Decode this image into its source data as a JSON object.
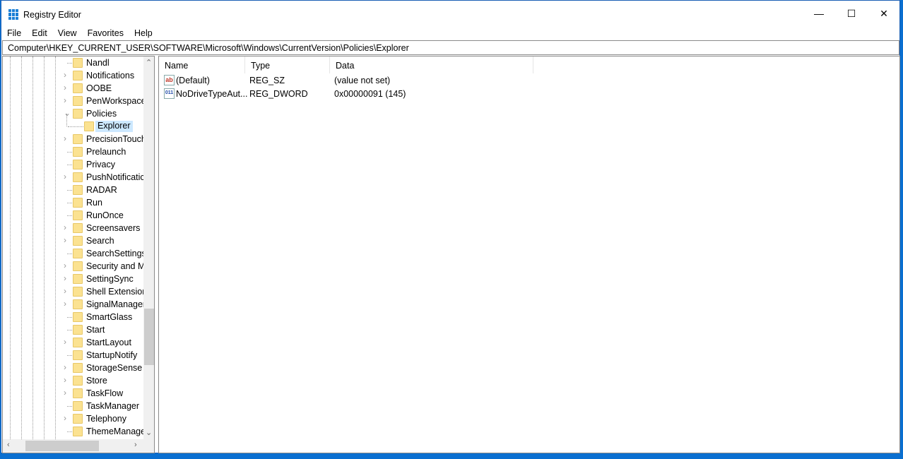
{
  "window": {
    "title": "Registry Editor",
    "minimize": "—",
    "maximize": "☐",
    "close": "✕"
  },
  "menu": [
    "File",
    "Edit",
    "View",
    "Favorites",
    "Help"
  ],
  "address": "Computer\\HKEY_CURRENT_USER\\SOFTWARE\\Microsoft\\Windows\\CurrentVersion\\Policies\\Explorer",
  "tree": [
    {
      "label": "Nandl",
      "expandable": false
    },
    {
      "label": "Notifications",
      "expandable": true
    },
    {
      "label": "OOBE",
      "expandable": true
    },
    {
      "label": "PenWorkspace",
      "expandable": true
    },
    {
      "label": "Policies",
      "expandable": true,
      "expanded": true
    },
    {
      "label": "Explorer",
      "child": true,
      "selected": true
    },
    {
      "label": "PrecisionTouch",
      "expandable": true
    },
    {
      "label": "Prelaunch",
      "expandable": false
    },
    {
      "label": "Privacy",
      "expandable": false
    },
    {
      "label": "PushNotificatic",
      "expandable": true
    },
    {
      "label": "RADAR",
      "expandable": false
    },
    {
      "label": "Run",
      "expandable": false
    },
    {
      "label": "RunOnce",
      "expandable": false
    },
    {
      "label": "Screensavers",
      "expandable": true
    },
    {
      "label": "Search",
      "expandable": true
    },
    {
      "label": "SearchSettings",
      "expandable": false
    },
    {
      "label": "Security and M",
      "expandable": true
    },
    {
      "label": "SettingSync",
      "expandable": true
    },
    {
      "label": "Shell Extension",
      "expandable": true
    },
    {
      "label": "SignalManager",
      "expandable": true
    },
    {
      "label": "SmartGlass",
      "expandable": false
    },
    {
      "label": "Start",
      "expandable": false
    },
    {
      "label": "StartLayout",
      "expandable": true
    },
    {
      "label": "StartupNotify",
      "expandable": false
    },
    {
      "label": "StorageSense",
      "expandable": true
    },
    {
      "label": "Store",
      "expandable": true
    },
    {
      "label": "TaskFlow",
      "expandable": true
    },
    {
      "label": "TaskManager",
      "expandable": false
    },
    {
      "label": "Telephony",
      "expandable": true
    },
    {
      "label": "ThemeManage",
      "expandable": false
    }
  ],
  "columns": {
    "name": "Name",
    "type": "Type",
    "data": "Data"
  },
  "values": [
    {
      "icon": "ab",
      "name": "(Default)",
      "type": "REG_SZ",
      "data": "(value not set)"
    },
    {
      "icon": "011",
      "name": "NoDriveTypeAut...",
      "type": "REG_DWORD",
      "data": "0x00000091 (145)"
    }
  ]
}
